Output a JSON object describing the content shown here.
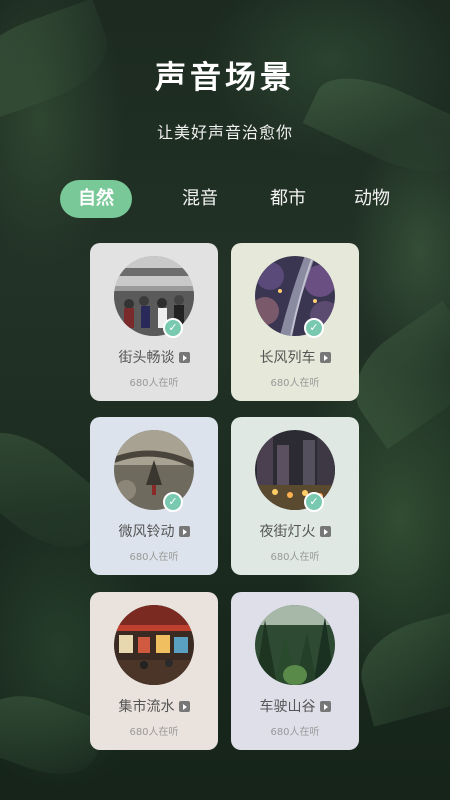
{
  "header": {
    "title": "声音场景",
    "subtitle": "让美好声音治愈你"
  },
  "tabs": [
    {
      "label": "自然",
      "active": true
    },
    {
      "label": "混音",
      "active": false
    },
    {
      "label": "都市",
      "active": false
    },
    {
      "label": "动物",
      "active": false
    }
  ],
  "cards": [
    {
      "name": "街头畅谈",
      "listeners": "680人在听",
      "selected": true,
      "icon": "play-icon",
      "bg": "#e2e2e2"
    },
    {
      "name": "长风列车",
      "listeners": "680人在听",
      "selected": true,
      "icon": "play-icon",
      "bg": "#e6e8d9"
    },
    {
      "name": "微风铃动",
      "listeners": "680人在听",
      "selected": true,
      "icon": "play-icon",
      "bg": "#dde3ec"
    },
    {
      "name": "夜街灯火",
      "listeners": "680人在听",
      "selected": true,
      "icon": "play-icon",
      "bg": "#dfe8e2"
    },
    {
      "name": "集市流水",
      "listeners": "680人在听",
      "selected": false,
      "icon": "play-icon",
      "bg": "#eae3dd"
    },
    {
      "name": "车驶山谷",
      "listeners": "680人在听",
      "selected": false,
      "icon": "play-icon",
      "bg": "#dedfe9"
    }
  ],
  "colors": {
    "accent": "#79c898",
    "check": "#79c9b0"
  }
}
